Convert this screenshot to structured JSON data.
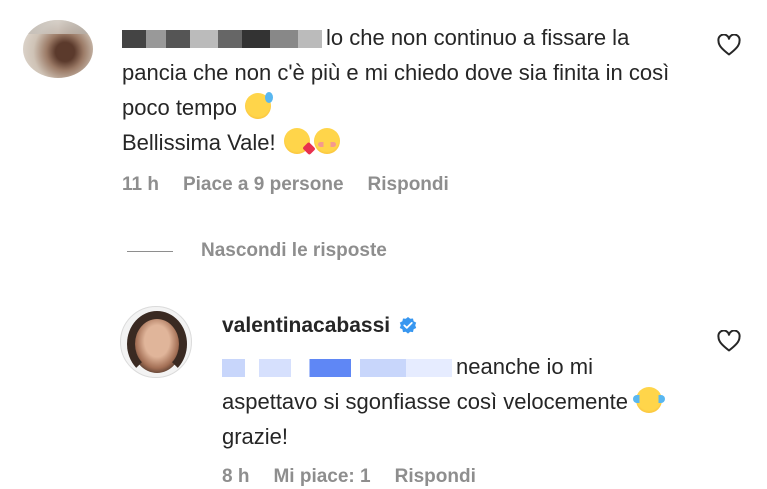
{
  "comment": {
    "username_redacted": "_____ggio",
    "text": "lo che non continuo a fissare la pancia che non c'è più e mi chiedo dove sia finita in così poco tempo",
    "text_end": "Bellissima Vale!",
    "time": "11 h",
    "likes": "Piace a 9 persone",
    "reply_label": "Rispondi"
  },
  "replies_toggle": {
    "label": "Nascondi le risposte"
  },
  "reply": {
    "username": "valentinacabassi",
    "mention_redacted": "@_____ggio",
    "text": "neanche io mi aspettavo si sgonfiasse così velocemente",
    "text_end": "grazie!",
    "time": "8 h",
    "likes": "Mi piace: 1",
    "reply_label": "Rispondi"
  },
  "icons": {
    "like": "heart-outline-icon",
    "verified": "verified-badge-icon"
  },
  "colors": {
    "verified": "#3897f0",
    "text": "#262626",
    "muted": "#8e8e8e"
  }
}
